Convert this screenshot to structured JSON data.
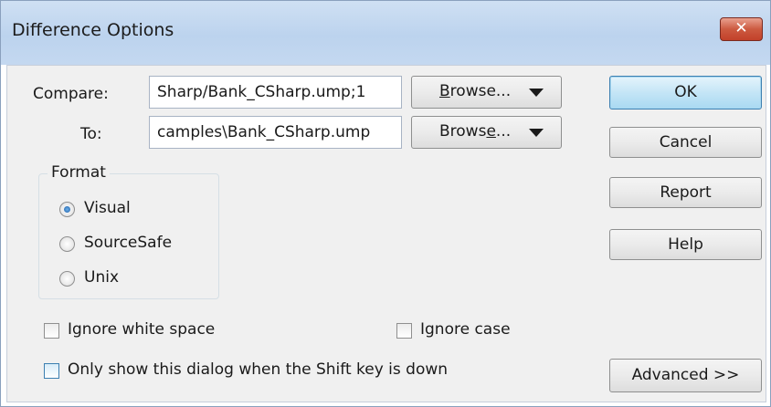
{
  "window": {
    "title": "Difference Options",
    "close_glyph": "✕"
  },
  "compare": {
    "label": "Compare:",
    "value": "Sharp/Bank_CSharp.ump;1",
    "browse_pre": "",
    "browse_u": "B",
    "browse_post": "rowse...",
    "browse_icon": "dropdown-arrow"
  },
  "to": {
    "label": "To:",
    "value": "camples\\Bank_CSharp.ump",
    "browse_pre": "Brows",
    "browse_u": "e",
    "browse_post": "...",
    "browse_icon": "dropdown-arrow"
  },
  "format": {
    "title": "Format",
    "options": [
      {
        "label": "Visual",
        "selected": true
      },
      {
        "label": "SourceSafe",
        "selected": false
      },
      {
        "label": "Unix",
        "selected": false
      }
    ]
  },
  "options": {
    "ignore_white_space": "Ignore white space",
    "ignore_case": "Ignore case",
    "only_show_dialog": "Only show this dialog when the Shift key is down"
  },
  "buttons": {
    "ok": "OK",
    "cancel": "Cancel",
    "report": "Report",
    "help": "Help",
    "advanced": "Advanced >>"
  },
  "colors": {
    "accent": "#3c7fb1",
    "close": "#c2412a",
    "titlebar": "#bcd3ee",
    "dialog_bg": "#f0f0f0"
  }
}
